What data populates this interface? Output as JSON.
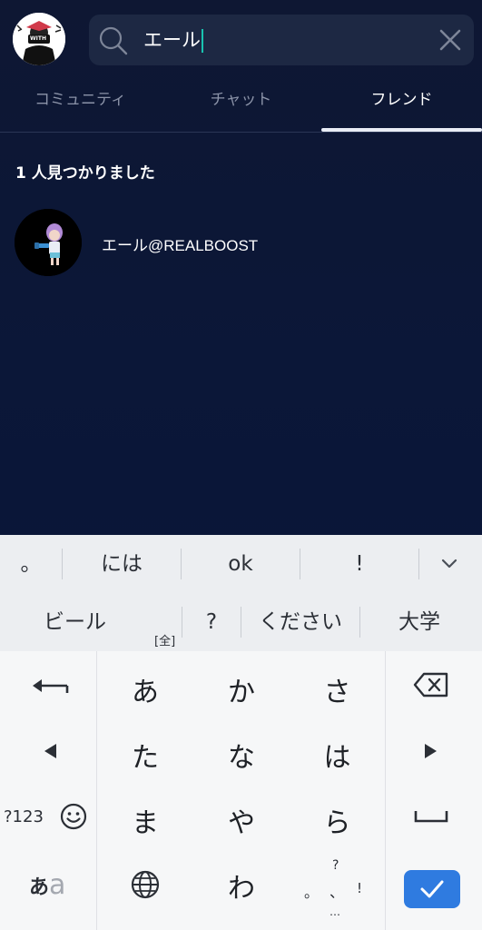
{
  "header": {
    "avatar_text": "WITH",
    "search": {
      "value": "エール"
    }
  },
  "tabs": [
    {
      "label": "コミュニティ",
      "active": false
    },
    {
      "label": "チャット",
      "active": false
    },
    {
      "label": "フレンド",
      "active": true
    }
  ],
  "results": {
    "count_text": "1 人見つかりました",
    "friends": [
      {
        "name": "エール@REALBOOST"
      }
    ]
  },
  "keyboard": {
    "suggestions_row1": [
      "。",
      "には",
      "ok",
      "!"
    ],
    "suggestions_row2": [
      "ビール",
      "?",
      "ください",
      "大学"
    ],
    "suggestion_tag": "[全]",
    "keys": {
      "row1": [
        "あ",
        "か",
        "さ"
      ],
      "row2": [
        "た",
        "な",
        "は"
      ],
      "row3": [
        "ま",
        "や",
        "ら"
      ],
      "row4": [
        "わ"
      ],
      "num_label": "?123",
      "mode_label_main": "あ",
      "mode_label_sub": "a",
      "punct_top": "?",
      "punct_left": "。",
      "punct_mid": "、",
      "punct_right": "!",
      "punct_bottom": "…"
    }
  },
  "colors": {
    "accent_cursor": "#19c3b0",
    "enter_key": "#2f7be0",
    "background": "#0b1738"
  }
}
